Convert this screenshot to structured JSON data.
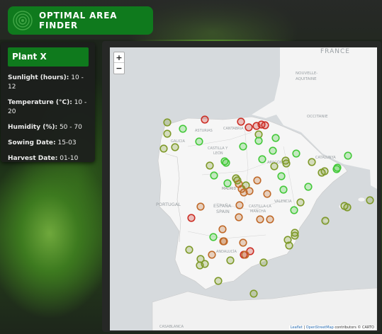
{
  "app": {
    "title": "OPTIMAL AREA FINDER"
  },
  "plant": {
    "name": "Plant X",
    "fields": [
      {
        "key": "Sunlight (hours):",
        "value": "10 - 12"
      },
      {
        "key": "Temperature (°C):",
        "value": "10 - 20"
      },
      {
        "key": "Humidity (%):",
        "value": "50 - 70"
      },
      {
        "key": "Sowing Date:",
        "value": "15-03"
      },
      {
        "key": "Harvest Date:",
        "value": "01-10"
      }
    ]
  },
  "map": {
    "zoom_in": "+",
    "zoom_out": "−",
    "attribution_prefix": "Leaflet",
    "attribution_mid": "OpenStreetMap",
    "attribution_tail": " contributors © CARTO",
    "labels": [
      {
        "text": "FRANCE",
        "cls": "big"
      },
      {
        "text": "NOUVELLE-",
        "cls": "small"
      },
      {
        "text": "AQUITAINE",
        "cls": "small"
      },
      {
        "text": "OCCITANIE",
        "cls": "small"
      },
      {
        "text": "CANTABRIA",
        "cls": "small"
      },
      {
        "text": "ASTURIAS",
        "cls": "small"
      },
      {
        "text": "GALICIA",
        "cls": "small"
      },
      {
        "text": "CASTILLA Y",
        "cls": "small"
      },
      {
        "text": "LEÓN",
        "cls": "small"
      },
      {
        "text": "ARAGÓN",
        "cls": "small"
      },
      {
        "text": "CATALUNYA",
        "cls": "small"
      },
      {
        "text": "PORTUGAL",
        "cls": "mid"
      },
      {
        "text": "ESPAÑA",
        "cls": "mid"
      },
      {
        "text": "SPAIN",
        "cls": "mid"
      },
      {
        "text": "CASTILLA-LA",
        "cls": "small"
      },
      {
        "text": "MANCHA",
        "cls": "small"
      },
      {
        "text": "VALENCIA",
        "cls": "small"
      },
      {
        "text": "ANDALUCÍA",
        "cls": "small"
      },
      {
        "text": "CASABLANCA",
        "cls": "small"
      },
      {
        "text": "MADRID",
        "cls": "small"
      }
    ]
  },
  "colors": {
    "brand": "#0f7a1d",
    "marker_green": "#44c93a",
    "marker_olive": "#7f9a2a",
    "marker_orange": "#c06a2a",
    "marker_red": "#cc2f26"
  }
}
